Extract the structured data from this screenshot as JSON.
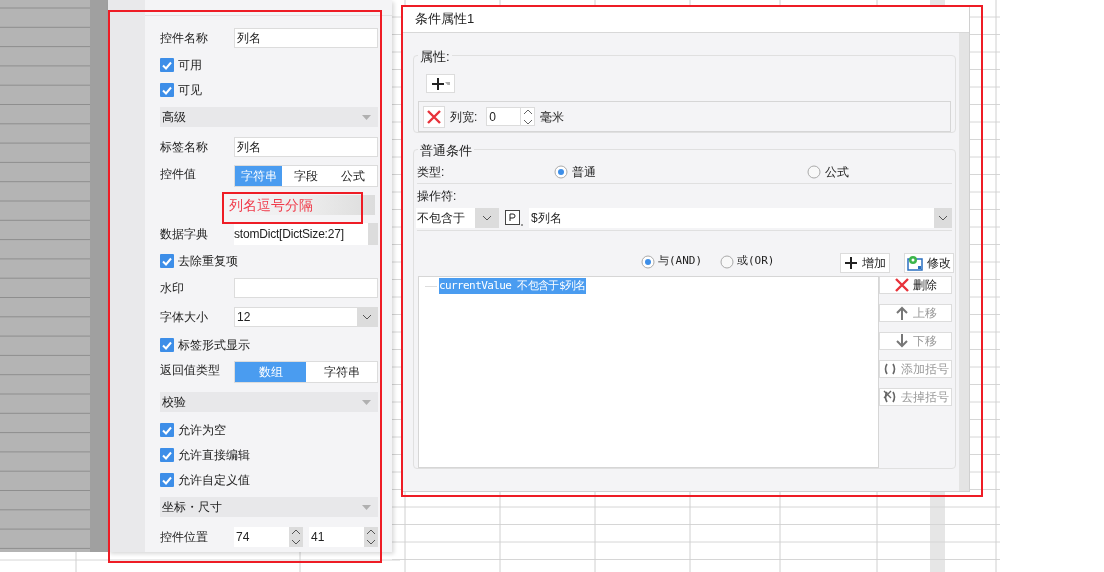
{
  "property_panel": {
    "rows": [
      {
        "kind": "field",
        "label": "控件名称",
        "value": "列名"
      },
      {
        "kind": "checkbox",
        "label": "可用",
        "checked": true
      },
      {
        "kind": "checkbox",
        "label": "可见",
        "checked": true
      },
      {
        "kind": "section",
        "label": "高级"
      },
      {
        "kind": "field",
        "label": "标签名称",
        "value": "列名"
      },
      {
        "kind": "segmented",
        "label": "控件值",
        "options": [
          {
            "label": "字符串",
            "selected": true
          },
          {
            "label": "字段",
            "selected": false
          },
          {
            "label": "公式",
            "selected": false
          }
        ]
      },
      {
        "kind": "annotation",
        "text": "列名逗号分隔"
      },
      {
        "kind": "dict",
        "label": "数据字典",
        "value": "stomDict[DictSize:27]"
      },
      {
        "kind": "checkbox",
        "label": "去除重复项",
        "checked": true
      },
      {
        "kind": "field",
        "label": "水印"
      },
      {
        "kind": "select",
        "label": "字体大小",
        "value": "12"
      },
      {
        "kind": "checkbox",
        "label": "标签形式显示",
        "checked": true
      },
      {
        "kind": "segmented",
        "label": "返回值类型",
        "options": [
          {
            "label": "数组",
            "selected": true
          },
          {
            "label": "字符串",
            "selected": false
          }
        ]
      },
      {
        "kind": "section",
        "label": "校验"
      },
      {
        "kind": "checkbox",
        "label": "允许为空",
        "checked": true
      },
      {
        "kind": "checkbox",
        "label": "允许直接编辑",
        "checked": true
      },
      {
        "kind": "checkbox",
        "label": "允许自定义值",
        "checked": true
      },
      {
        "kind": "section",
        "label": "坐标・尺寸"
      },
      {
        "kind": "spinners",
        "label": "控件位置",
        "values": [
          "74",
          "41"
        ]
      }
    ]
  },
  "dialog": {
    "title": "条件属性1",
    "properties": {
      "legend": "属性:",
      "rows": [
        {
          "label": "列宽:",
          "value": "0",
          "unit": "毫米"
        }
      ]
    },
    "condition": {
      "legend": "普通条件",
      "type_label": "类型:",
      "types": [
        {
          "label": "普通",
          "selected": true
        },
        {
          "label": "公式",
          "selected": false
        }
      ],
      "operator_label": "操作符:",
      "operator": "不包含于",
      "operand": "$列名",
      "logic": [
        {
          "label": "与(AND)",
          "selected": true
        },
        {
          "label": "或(OR)",
          "selected": false
        }
      ],
      "add_button": "增加",
      "modify_button": "修改",
      "conditions": [
        {
          "text": "currentValue 不包含于$列名",
          "selected": true
        }
      ],
      "side_buttons": [
        {
          "kind": "delete",
          "label": "删除",
          "disabled": false
        },
        {
          "kind": "up",
          "label": "上移",
          "disabled": true
        },
        {
          "kind": "down",
          "label": "下移",
          "disabled": true
        },
        {
          "kind": "add-parens",
          "label": "添加括号",
          "disabled": true
        },
        {
          "kind": "remove-parens",
          "label": "去掉括号",
          "disabled": true
        }
      ]
    }
  }
}
